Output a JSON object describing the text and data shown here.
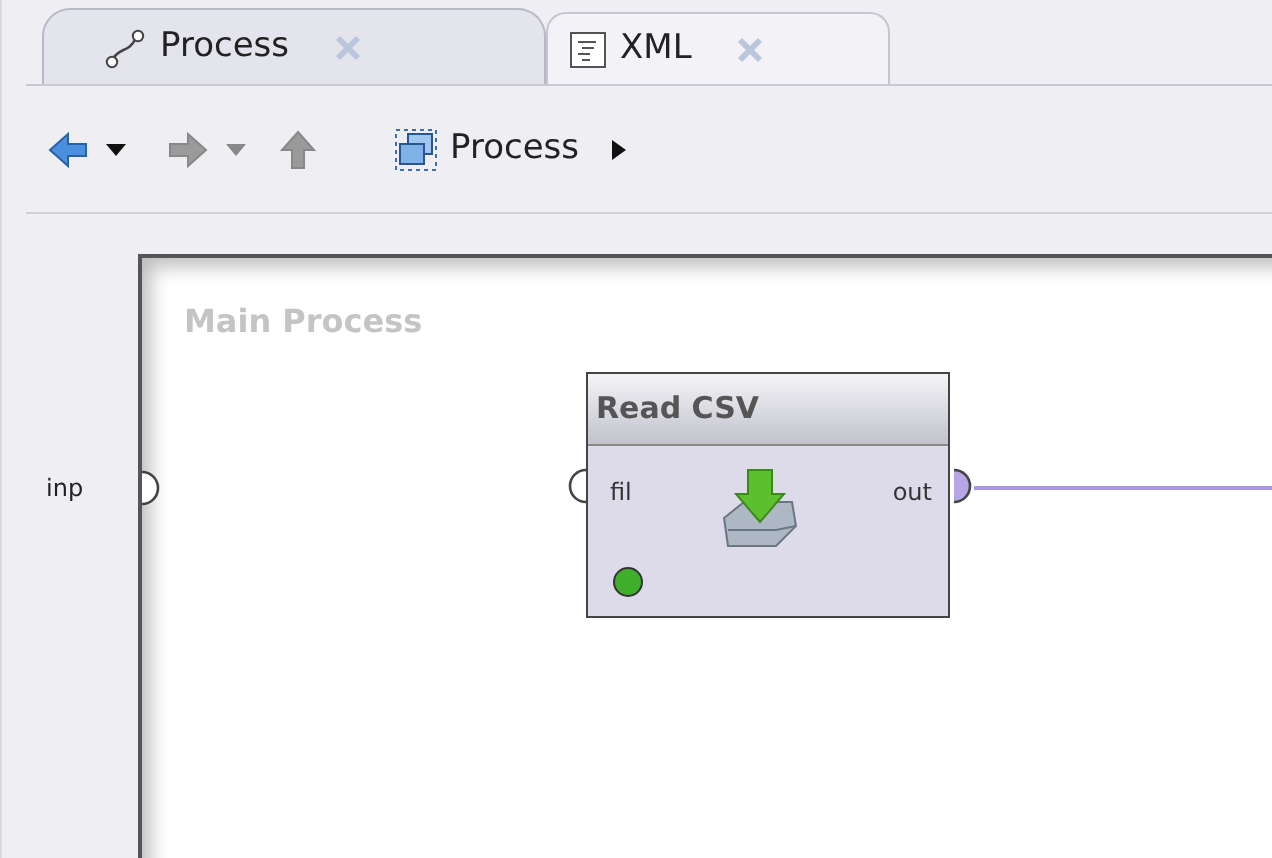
{
  "tabs": [
    {
      "label": "Process",
      "kind": "process",
      "selected": true
    },
    {
      "label": "XML",
      "kind": "xml",
      "selected": false
    }
  ],
  "toolbar": {
    "back_enabled": true,
    "forward_enabled": false,
    "up_enabled": false,
    "breadcrumb": "Process"
  },
  "process": {
    "title": "Main Process",
    "input_port": {
      "label": "inp",
      "connected": false
    },
    "operator": {
      "title": "Read CSV",
      "input_port": {
        "label": "fil",
        "connected": false
      },
      "output_port": {
        "label": "out",
        "connected": true
      },
      "ready": true
    }
  }
}
